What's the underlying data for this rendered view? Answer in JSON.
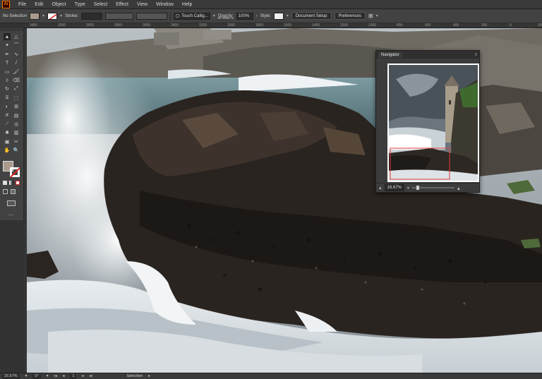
{
  "app": {
    "logo": "Ai",
    "accent": "#ff7c00"
  },
  "menu": [
    "File",
    "Edit",
    "Object",
    "Type",
    "Select",
    "Effect",
    "View",
    "Window",
    "Help"
  ],
  "control_bar": {
    "selection_label": "No Selection",
    "fill_color": "#a99a8c",
    "stroke_label": "Stroke:",
    "brush_name": "Touch Callig...",
    "opacity_label": "Opacity:",
    "opacity_value": "100%",
    "style_label": "Style:",
    "document_setup": "Document Setup",
    "preferences": "Preferences"
  },
  "ruler": {
    "ticks": [
      "3400",
      "3200",
      "3000",
      "2800",
      "2600",
      "2400",
      "2200",
      "2000",
      "1800",
      "1600",
      "1400",
      "1200",
      "1000",
      "800",
      "600",
      "400",
      "200",
      "0",
      "200",
      "400",
      "600"
    ]
  },
  "toolbar": {
    "tools": [
      "selection-tool",
      "direct-selection-tool",
      "magic-wand-tool",
      "lasso-tool",
      "pen-tool",
      "curvature-tool",
      "type-tool",
      "line-tool",
      "rectangle-tool",
      "paintbrush-tool",
      "shaper-tool",
      "eraser-tool",
      "rotate-tool",
      "scale-tool",
      "width-tool",
      "free-transform-tool",
      "shape-builder-tool",
      "perspective-grid-tool",
      "mesh-tool",
      "gradient-tool",
      "eyedropper-tool",
      "blend-tool",
      "symbol-sprayer-tool",
      "column-graph-tool",
      "artboard-tool",
      "slice-tool",
      "hand-tool",
      "zoom-tool"
    ],
    "fill_color": "#a99a8c",
    "more_label": "..."
  },
  "navigator": {
    "title": "Navigator",
    "zoom": "16.67%"
  },
  "status": {
    "zoom": "16.67%",
    "rotation": "0°",
    "artboard": "1",
    "tool": "Selection"
  }
}
